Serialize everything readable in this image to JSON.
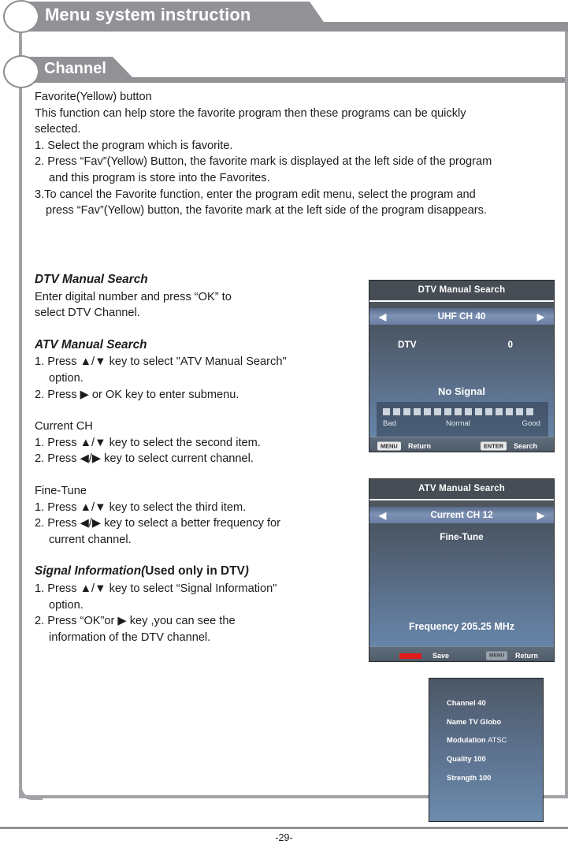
{
  "header": {
    "main_title": "Menu system instruction",
    "sub_title": "Channel"
  },
  "intro": {
    "heading": "Favorite(Yellow) button",
    "line1": "This function can help store the favorite program then these programs can be quickly",
    "line2": "selected.",
    "step1": "1. Select the program which is favorite.",
    "step2a": "2. Press “Fav”(Yellow) Button, the favorite mark is displayed at the left side of the program",
    "step2b": "and this program is store into the Favorites.",
    "step3a": "3.To cancel the Favorite function, enter the program edit menu, select the program and",
    "step3b": "press “Fav”(Yellow) button, the favorite mark at the left side of the program disappears."
  },
  "sections": {
    "dtv_manual_search": {
      "title": "DTV Manual Search",
      "line1": "Enter digital number and press “OK” to",
      "line2": "select DTV Channel."
    },
    "atv_manual_search": {
      "title": "ATV Manual Search",
      "step1a": "1. Press ▲/▼ key to select \"ATV Manual Search\"",
      "step1b": "option.",
      "step2": "2. Press ▶ or OK key to enter submenu."
    },
    "current_ch": {
      "title": "Current CH",
      "step1": "1. Press ▲/▼ key to select the second item.",
      "step2": "2. Press ◀/▶ key to select current channel."
    },
    "fine_tune": {
      "title": "Fine-Tune",
      "step1": "1. Press ▲/▼ key to select the third item.",
      "step2a": "2. Press ◀/▶ key to select a better frequency for",
      "step2b": "current channel."
    },
    "signal_information": {
      "title_italic": "Signal Information(",
      "title_bold": "Used only in DTV",
      "title_close": ")",
      "step1a": "1. Press ▲/▼ key to select “Signal Information\"",
      "step1b": "option.",
      "step2a": "2. Press “OK”or ▶ key ,you can see the",
      "step2b": "information of  the DTV channel."
    }
  },
  "osd_dtv": {
    "title": "DTV Manual Search",
    "selected_row": "UHF CH 40",
    "arrow_left": "◀",
    "arrow_right": "▶",
    "label_dtv": "DTV",
    "value_dtv": "0",
    "status": "No  Signal",
    "meter": {
      "blocks": 15,
      "label_bad": "Bad",
      "label_normal": "Normal",
      "label_good": "Good"
    },
    "footer": {
      "key_menu": "MENU",
      "action_menu": "Return",
      "key_enter": "ENTER",
      "action_enter": "Search"
    }
  },
  "osd_atv": {
    "title": "ATV Manual Search",
    "selected_row": "Current CH 12",
    "arrow_left": "◀",
    "arrow_right": "▶",
    "item_fine_tune": "Fine-Tune",
    "frequency": "Frequency 205.25 MHz",
    "footer": {
      "action_save": "Save",
      "key_menu": "MENU",
      "action_menu": "Return"
    }
  },
  "osd_info": {
    "channel_label": "Channel",
    "channel_value": "40",
    "name_label": "Name",
    "name_value": "TV Globo",
    "modulation_label": "Modulation",
    "modulation_value": "ATSC",
    "quality_label": "Quality",
    "quality_value": "100",
    "strength_label": "Strength",
    "strength_value": "100"
  },
  "footer": {
    "page_number": "-29-"
  },
  "colors": {
    "banner_gray": "#919196",
    "osd_header": "#474d55",
    "osd_highlight": "#6b7fa4",
    "red_key": "#e01b1b"
  }
}
